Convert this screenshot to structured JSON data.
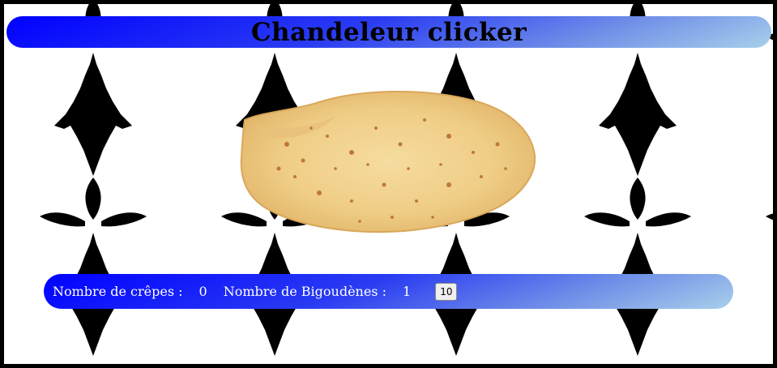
{
  "header": {
    "title": "Chandeleur clicker"
  },
  "crepe": {
    "icon": "crepe-pancake-image"
  },
  "stats": {
    "crepes_label": "Nombre de crêpes :",
    "crepes_value": "0",
    "bigoudenes_label": "Nombre de Bigoudènes :",
    "bigoudenes_value": "1",
    "upgrade_button_label": "10"
  },
  "background": {
    "pattern": "ermine-spots-icon",
    "color": "#000000"
  },
  "colors": {
    "gradient_start": "#0000ff",
    "gradient_end": "#a8d0ea",
    "border": "#000000",
    "text_on_bar": "#ffffff"
  }
}
